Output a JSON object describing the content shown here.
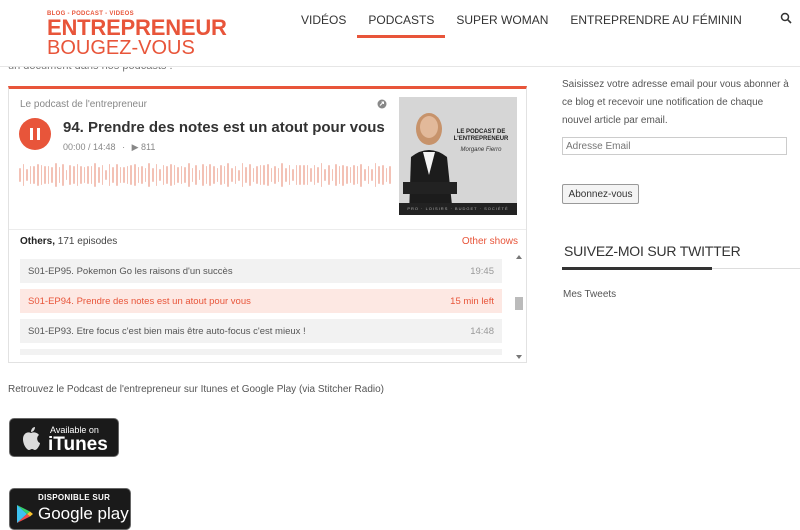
{
  "header": {
    "logo_tag": "BLOG - PODCAST - VIDEOS",
    "logo_main": "ENTREPRENEUR",
    "logo_sub": "BOUGEZ-VOUS",
    "nav": [
      "VIDÉOS",
      "PODCASTS",
      "SUPER WOMAN",
      "ENTREPRENDRE AU FÉMININ"
    ],
    "active_nav": "PODCASTS",
    "search_icon": "search-icon"
  },
  "clipped_text": "un document dans nos podcasts !",
  "player": {
    "podcast_name": "Le podcast de l'entrepreneur",
    "episode_title": "94. Prendre des notes est un atout pour vous",
    "time": "00:00 / 14:48",
    "plays": "811",
    "cover": {
      "title": "LE PODCAST DE L'ENTREPRENEUR",
      "signature": "Morgane Fierro",
      "bar": "PRO · LOISIRS · BUDGET · SOCIÉTÉ"
    },
    "others_label": "Others,",
    "episode_count": "171 episodes",
    "other_shows": "Other shows",
    "episodes": [
      {
        "title": "S01-EP95. Pokemon Go les raisons d'un succès",
        "duration": "19:45",
        "active": false
      },
      {
        "title": "S01-EP94. Prendre des notes est un atout pour vous",
        "duration": "15 min left",
        "active": true
      },
      {
        "title": "S01-EP93. Etre focus c'est bien mais être auto-focus c'est mieux !",
        "duration": "14:48",
        "active": false
      }
    ]
  },
  "find_text": "Retrouvez le Podcast de l'entrepreneur sur Itunes et Google Play (via Stitcher Radio)",
  "badges": {
    "itunes_small": "Available on",
    "itunes_big": "iTunes",
    "gplay_small": "DISPONIBLE SUR",
    "gplay_big": "Google play"
  },
  "sidebar": {
    "intro": "Saisissez votre adresse email pour vous abonner à ce blog et recevoir une notification de chaque nouvel article par email.",
    "email_placeholder": "Adresse Email",
    "subscribe": "Abonnez-vous",
    "twitter_title": "SUIVEZ-MOI SUR TWITTER",
    "my_tweets": "Mes Tweets"
  },
  "colors": {
    "accent": "#e8553a"
  }
}
